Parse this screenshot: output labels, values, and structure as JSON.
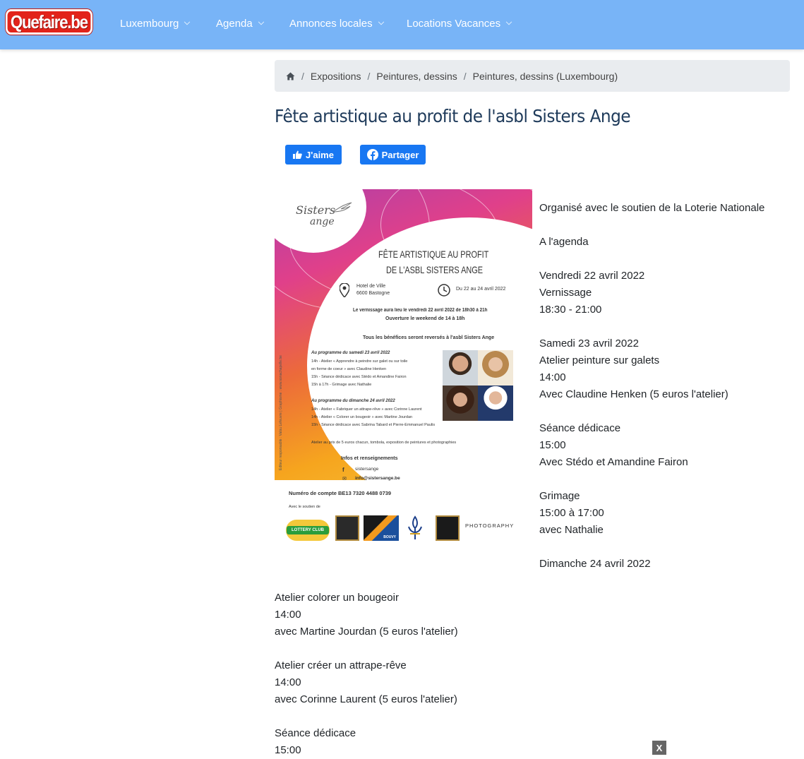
{
  "nav": {
    "logo": "Quefaire.be",
    "items": [
      "Luxembourg",
      "Agenda",
      "Annonces locales",
      "Locations Vacances"
    ]
  },
  "breadcrumb": [
    "Expositions",
    "Peintures, dessins",
    "Peintures, dessins (Luxembourg)"
  ],
  "title": "Fête artistique au profit de l'asbl Sisters Ange",
  "social": {
    "like": "J'aime",
    "share": "Partager"
  },
  "poster": {
    "logo_line1": "Sisters",
    "logo_line2": "ange",
    "heading1": "FÊTE ARTISTIQUE AU PROFIT",
    "heading2": "DE L'ASBL SISTERS ANGE",
    "venue1": "Hotel de Ville",
    "venue2": "6600 Bastogne",
    "dates": "Du 22 au 24 avril 2022",
    "vernissage": "Le vernissage aura lieu le vendredi 22 avril 2022 de 18h30 à 21h",
    "ouverture": "Ouverture le weekend de 14 à 18h",
    "benefices": "Tous les bénéfices seront reversés à l'asbl Sisters Ange",
    "sat_head": "Au programme du samedi 23 avril 2022",
    "sat_lines": [
      "14h - Atelier « Apprendre à peindre sur galet ou sur toile",
      "en forme de coeur » avec Claudine Henken",
      "15h - Séance dédicace avec Stédo et Amandine Fairon",
      "15h à 17h - Grimage avec Nathalie"
    ],
    "sun_head": "Au programme du dimanche 24 avril 2022",
    "sun_lines": [
      "14h - Atelier « Fabriquer un attrape-rêve » avec Corinne Laurent",
      "14h - Atelier « Colorer un bougeoir » avec Martine Jourdan",
      "15h - Séance dédicace avec Sabrina Tabard et Pierre-Emmanuel Paulis"
    ],
    "atelier_prix": "Atelier au prix de 5 euros chacun, tombola, exposition de peintures et photographies",
    "infos_head": "Infos et renseignements",
    "facebook": "sistersange",
    "email": "info@sistersange.be",
    "compte": "Numéro de compte BE13 7320 4488 0739",
    "soutien": "Avec le soutien de",
    "editeur": "Editeur responsable : Valou Lefeuvre | Graphisme : www.sonachapelle.be",
    "sponsor_lottery": "LOTTERY CLUB",
    "sponsor_photo": "PHOTOGRAPHY",
    "sponsor_bouvy": "BOUVY"
  },
  "description_right": [
    "Organisé avec le soutien de la Loterie Nationale",
    "",
    "A l'agenda",
    "",
    "Vendredi 22 avril 2022",
    "Vernissage",
    "18:30 - 21:00",
    "",
    "Samedi 23 avril 2022",
    "Atelier peinture sur galets",
    "14:00",
    "Avec Claudine Henken (5 euros l'atelier)",
    "",
    "Séance dédicace",
    "15:00",
    "Avec Stédo et Amandine Fairon",
    "",
    "Grimage",
    "15:00 à 17:00",
    "avec Nathalie",
    "",
    "Dimanche 24 avril 2022"
  ],
  "description_bottom": [
    "Atelier colorer un bougeoir",
    "14:00",
    "avec Martine Jourdan (5 euros l'atelier)",
    "",
    "Atelier créer un attrape-rêve",
    "14:00",
    "avec Corinne Laurent (5 euros l'atelier)",
    "",
    "Séance dédicace",
    "15:00"
  ],
  "close_label": "X"
}
